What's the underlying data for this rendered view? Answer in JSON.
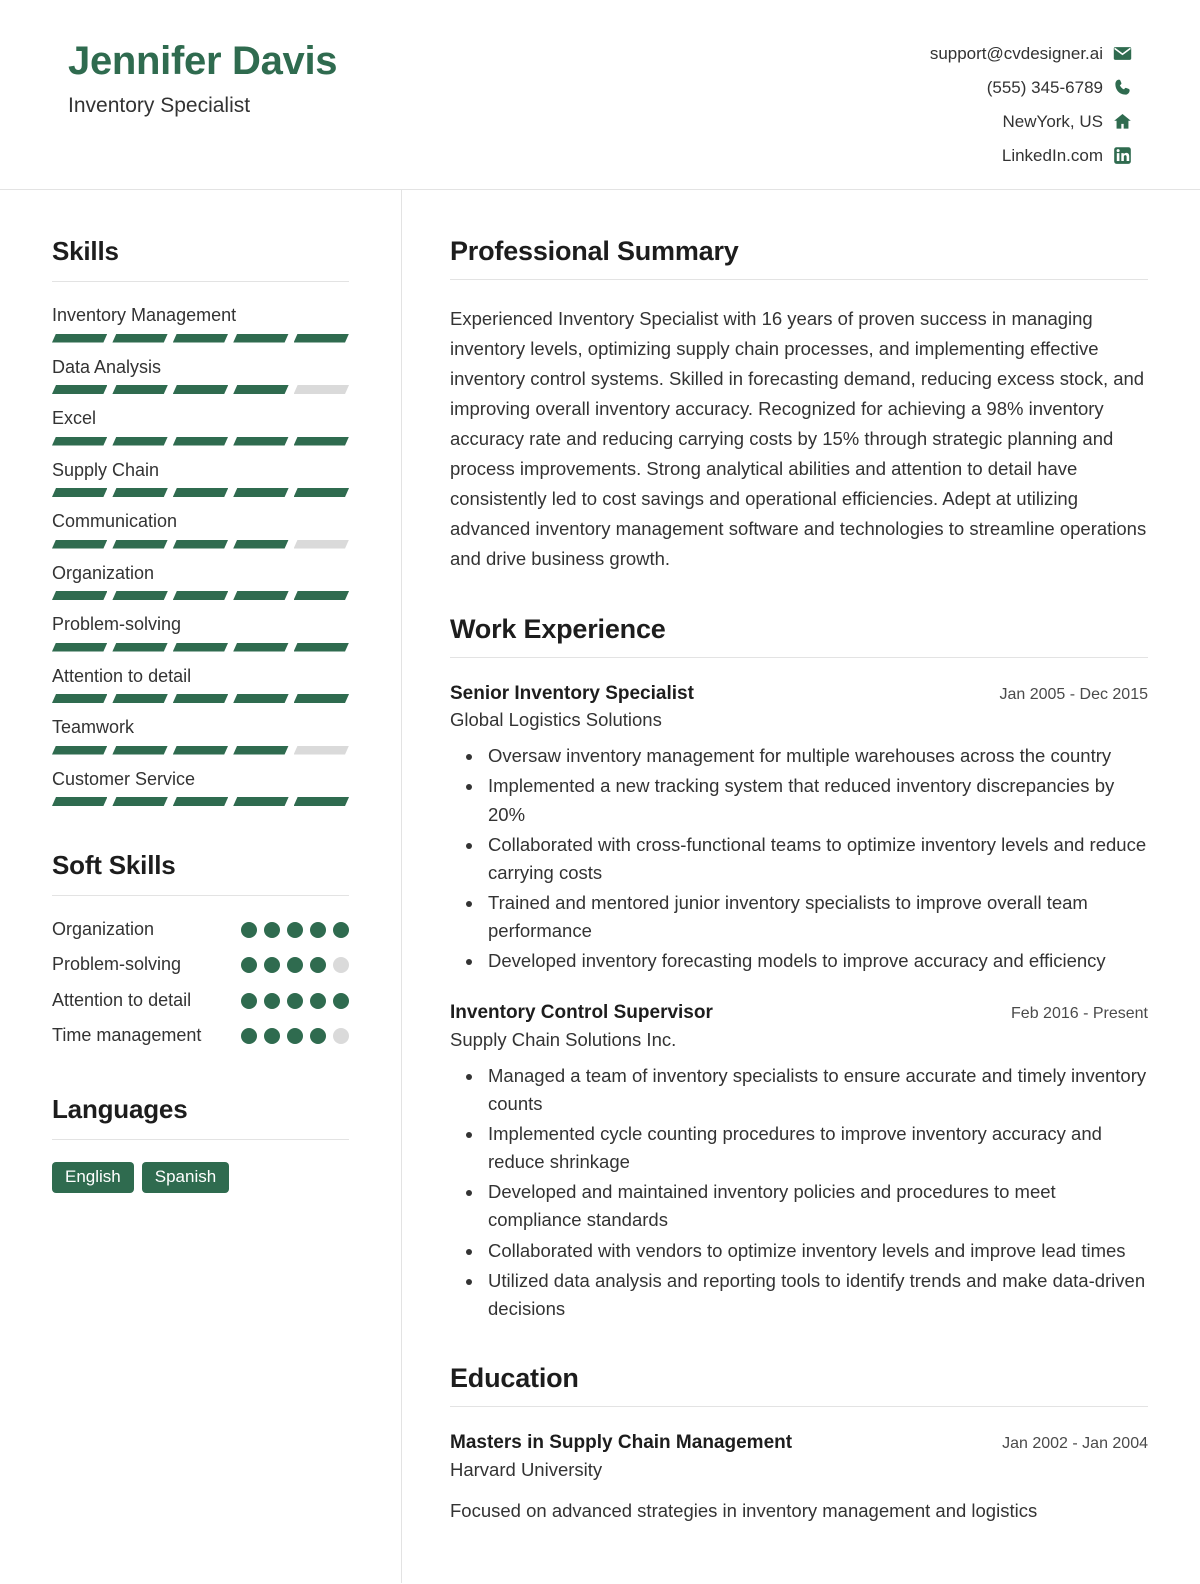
{
  "theme": {
    "accent": "#2f6b4f",
    "muted": "#dadada",
    "rule": "#e3e3e3",
    "text": "#333333"
  },
  "header": {
    "name": "Jennifer Davis",
    "role": "Inventory Specialist",
    "contacts": [
      {
        "icon": "envelope-icon",
        "value": "support@cvdesigner.ai"
      },
      {
        "icon": "phone-icon",
        "value": "(555) 345-6789"
      },
      {
        "icon": "home-icon",
        "value": "NewYork, US"
      },
      {
        "icon": "linkedin-icon",
        "value": "LinkedIn.com"
      }
    ]
  },
  "sidebar": {
    "skills": {
      "title": "Skills",
      "max": 5,
      "items": [
        {
          "label": "Inventory Management",
          "level": 5
        },
        {
          "label": "Data Analysis",
          "level": 4
        },
        {
          "label": "Excel",
          "level": 5
        },
        {
          "label": "Supply Chain",
          "level": 5
        },
        {
          "label": "Communication",
          "level": 4
        },
        {
          "label": "Organization",
          "level": 5
        },
        {
          "label": "Problem-solving",
          "level": 5
        },
        {
          "label": "Attention to detail",
          "level": 5
        },
        {
          "label": "Teamwork",
          "level": 4
        },
        {
          "label": "Customer Service",
          "level": 5
        }
      ]
    },
    "soft_skills": {
      "title": "Soft Skills",
      "max": 5,
      "items": [
        {
          "label": "Organization",
          "level": 5
        },
        {
          "label": "Problem-solving",
          "level": 4
        },
        {
          "label": "Attention to detail",
          "level": 5
        },
        {
          "label": "Time management",
          "level": 4
        }
      ]
    },
    "languages": {
      "title": "Languages",
      "items": [
        "English",
        "Spanish"
      ]
    }
  },
  "main": {
    "summary": {
      "title": "Professional Summary",
      "text": "Experienced Inventory Specialist with 16 years of proven success in managing inventory levels, optimizing supply chain processes, and implementing effective inventory control systems. Skilled in forecasting demand, reducing excess stock, and improving overall inventory accuracy. Recognized for achieving a 98% inventory accuracy rate and reducing carrying costs by 15% through strategic planning and process improvements. Strong analytical abilities and attention to detail have consistently led to cost savings and operational efficiencies. Adept at utilizing advanced inventory management software and technologies to streamline operations and drive business growth."
    },
    "experience": {
      "title": "Work Experience",
      "entries": [
        {
          "title": "Senior Inventory Specialist",
          "org": "Global Logistics Solutions",
          "date": "Jan 2005 - Dec 2015",
          "bullets": [
            "Oversaw inventory management for multiple warehouses across the country",
            "Implemented a new tracking system that reduced inventory discrepancies by 20%",
            "Collaborated with cross-functional teams to optimize inventory levels and reduce carrying costs",
            "Trained and mentored junior inventory specialists to improve overall team performance",
            "Developed inventory forecasting models to improve accuracy and efficiency"
          ]
        },
        {
          "title": "Inventory Control Supervisor",
          "org": "Supply Chain Solutions Inc.",
          "date": "Feb 2016 - Present",
          "bullets": [
            "Managed a team of inventory specialists to ensure accurate and timely inventory counts",
            "Implemented cycle counting procedures to improve inventory accuracy and reduce shrinkage",
            "Developed and maintained inventory policies and procedures to meet compliance standards",
            "Collaborated with vendors to optimize inventory levels and improve lead times",
            "Utilized data analysis and reporting tools to identify trends and make data-driven decisions"
          ]
        }
      ]
    },
    "education": {
      "title": "Education",
      "entries": [
        {
          "title": "Masters in Supply Chain Management",
          "org": "Harvard University",
          "date": "Jan 2002 - Jan 2004",
          "description": "Focused on advanced strategies in inventory management and logistics"
        }
      ]
    }
  }
}
